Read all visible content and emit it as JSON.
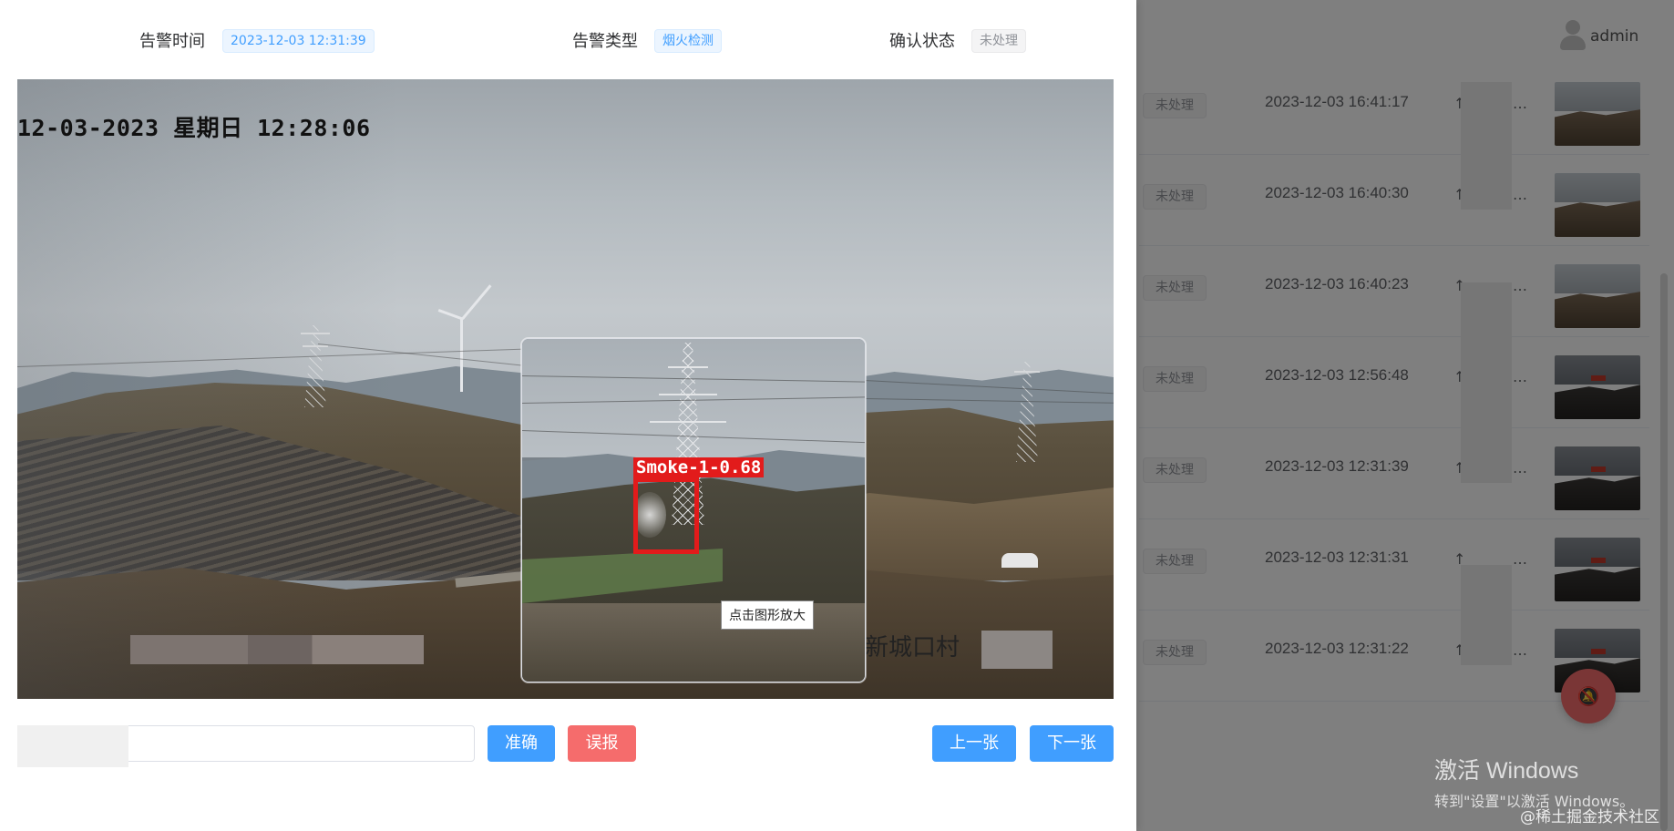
{
  "header": {
    "username": "admin"
  },
  "alarm": {
    "time_label": "告警时间",
    "time_value": "2023-12-03 12:31:39",
    "type_label": "告警类型",
    "type_value": "烟火检测",
    "status_label": "确认状态",
    "status_value": "未处理"
  },
  "image": {
    "camera_timestamp": "12-03-2023 星期日 12:28:06",
    "location_text": "新城口村",
    "detection_label": "Smoke-1-0.68",
    "zoom_tooltip": "点击图形放大"
  },
  "actions": {
    "remark_value": "",
    "confirm_label": "准确",
    "false_alarm_label": "误报",
    "prev_label": "上一张",
    "next_label": "下一张"
  },
  "alarm_list": [
    {
      "status": "未处理",
      "time": "2023-12-03 16:41:17",
      "type_trunc": "…"
    },
    {
      "status": "未处理",
      "time": "2023-12-03 16:40:30",
      "type_trunc": "…"
    },
    {
      "status": "未处理",
      "time": "2023-12-03 16:40:23",
      "type_trunc": "…"
    },
    {
      "status": "未处理",
      "time": "2023-12-03 12:56:48",
      "type_trunc": "…"
    },
    {
      "status": "未处理",
      "time": "2023-12-03 12:31:39",
      "type_trunc": "…"
    },
    {
      "status": "未处理",
      "time": "2023-12-03 12:31:31",
      "type_trunc": "…"
    },
    {
      "status": "未处理",
      "time": "2023-12-03 12:31:22",
      "type_trunc": "…"
    }
  ],
  "fab": {
    "icon": "bell-off-icon"
  },
  "watermark": {
    "title": "激活 Windows",
    "subtitle": "转到\"设置\"以激活 Windows。",
    "site": "@稀土掘金技术社区"
  },
  "colors": {
    "primary": "#409eff",
    "danger": "#f56c6c",
    "detection": "#e21b1b",
    "tag_blue_bg": "#ecf5ff",
    "tag_gray_bg": "#f4f4f5"
  }
}
